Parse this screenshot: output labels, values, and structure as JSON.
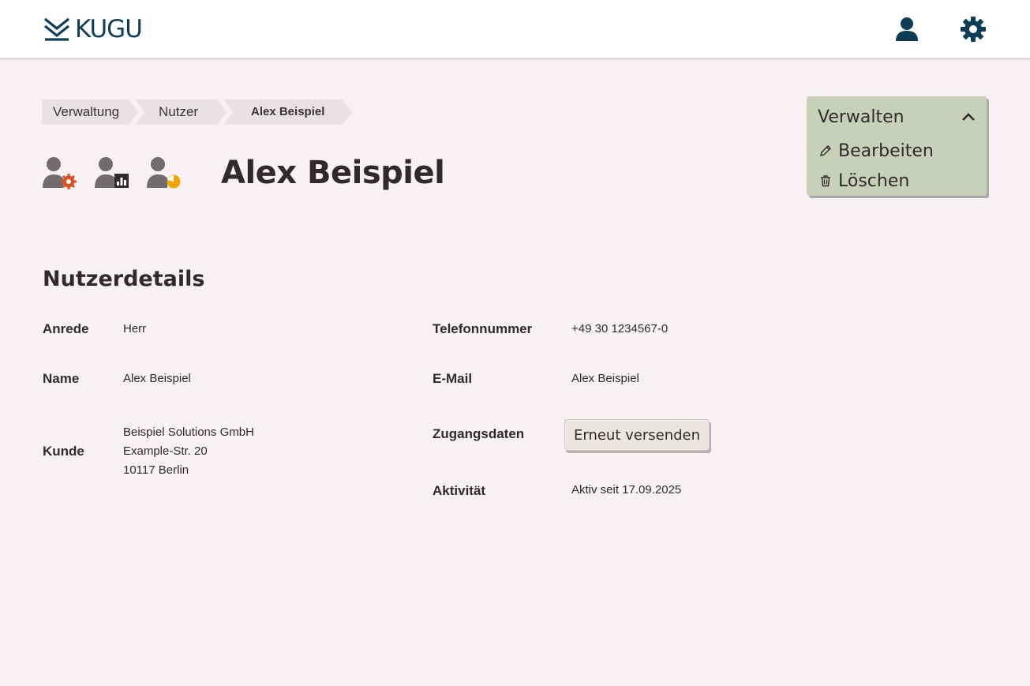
{
  "header": {
    "logo_text": "KUGU",
    "brand_color": "#0e3d57",
    "icons": [
      "user-icon",
      "gear-icon"
    ]
  },
  "breadcrumb": [
    "Verwaltung",
    "Nutzer",
    "Alex Beispiel"
  ],
  "page": {
    "title": "Alex Beispiel",
    "role_icons": [
      "user-admin-icon",
      "user-report-icon",
      "user-energy-icon"
    ]
  },
  "manage_menu": {
    "title": "Verwalten",
    "items": [
      {
        "label": "Bearbeiten",
        "icon": "pencil-icon"
      },
      {
        "label": "Löschen",
        "icon": "trash-icon"
      }
    ]
  },
  "details": {
    "section_title": "Nutzerdetails",
    "salutation_label": "Anrede",
    "salutation": "Herr",
    "name_label": "Name",
    "name": "Alex Beispiel",
    "customer_label": "Kunde",
    "customer_lines": [
      "Beispiel Solutions GmbH",
      "Example-Str. 20",
      "10117 Berlin"
    ],
    "phone_label": "Telefonnummer",
    "phone": "+49 30 1234567-0",
    "email_label": "E-Mail",
    "email": "Alex Beispiel",
    "credentials_label": "Zugangsdaten",
    "resend_label": "Erneut versenden",
    "activity_label": "Aktivität",
    "activity": "Aktiv seit 17.09.2025"
  }
}
